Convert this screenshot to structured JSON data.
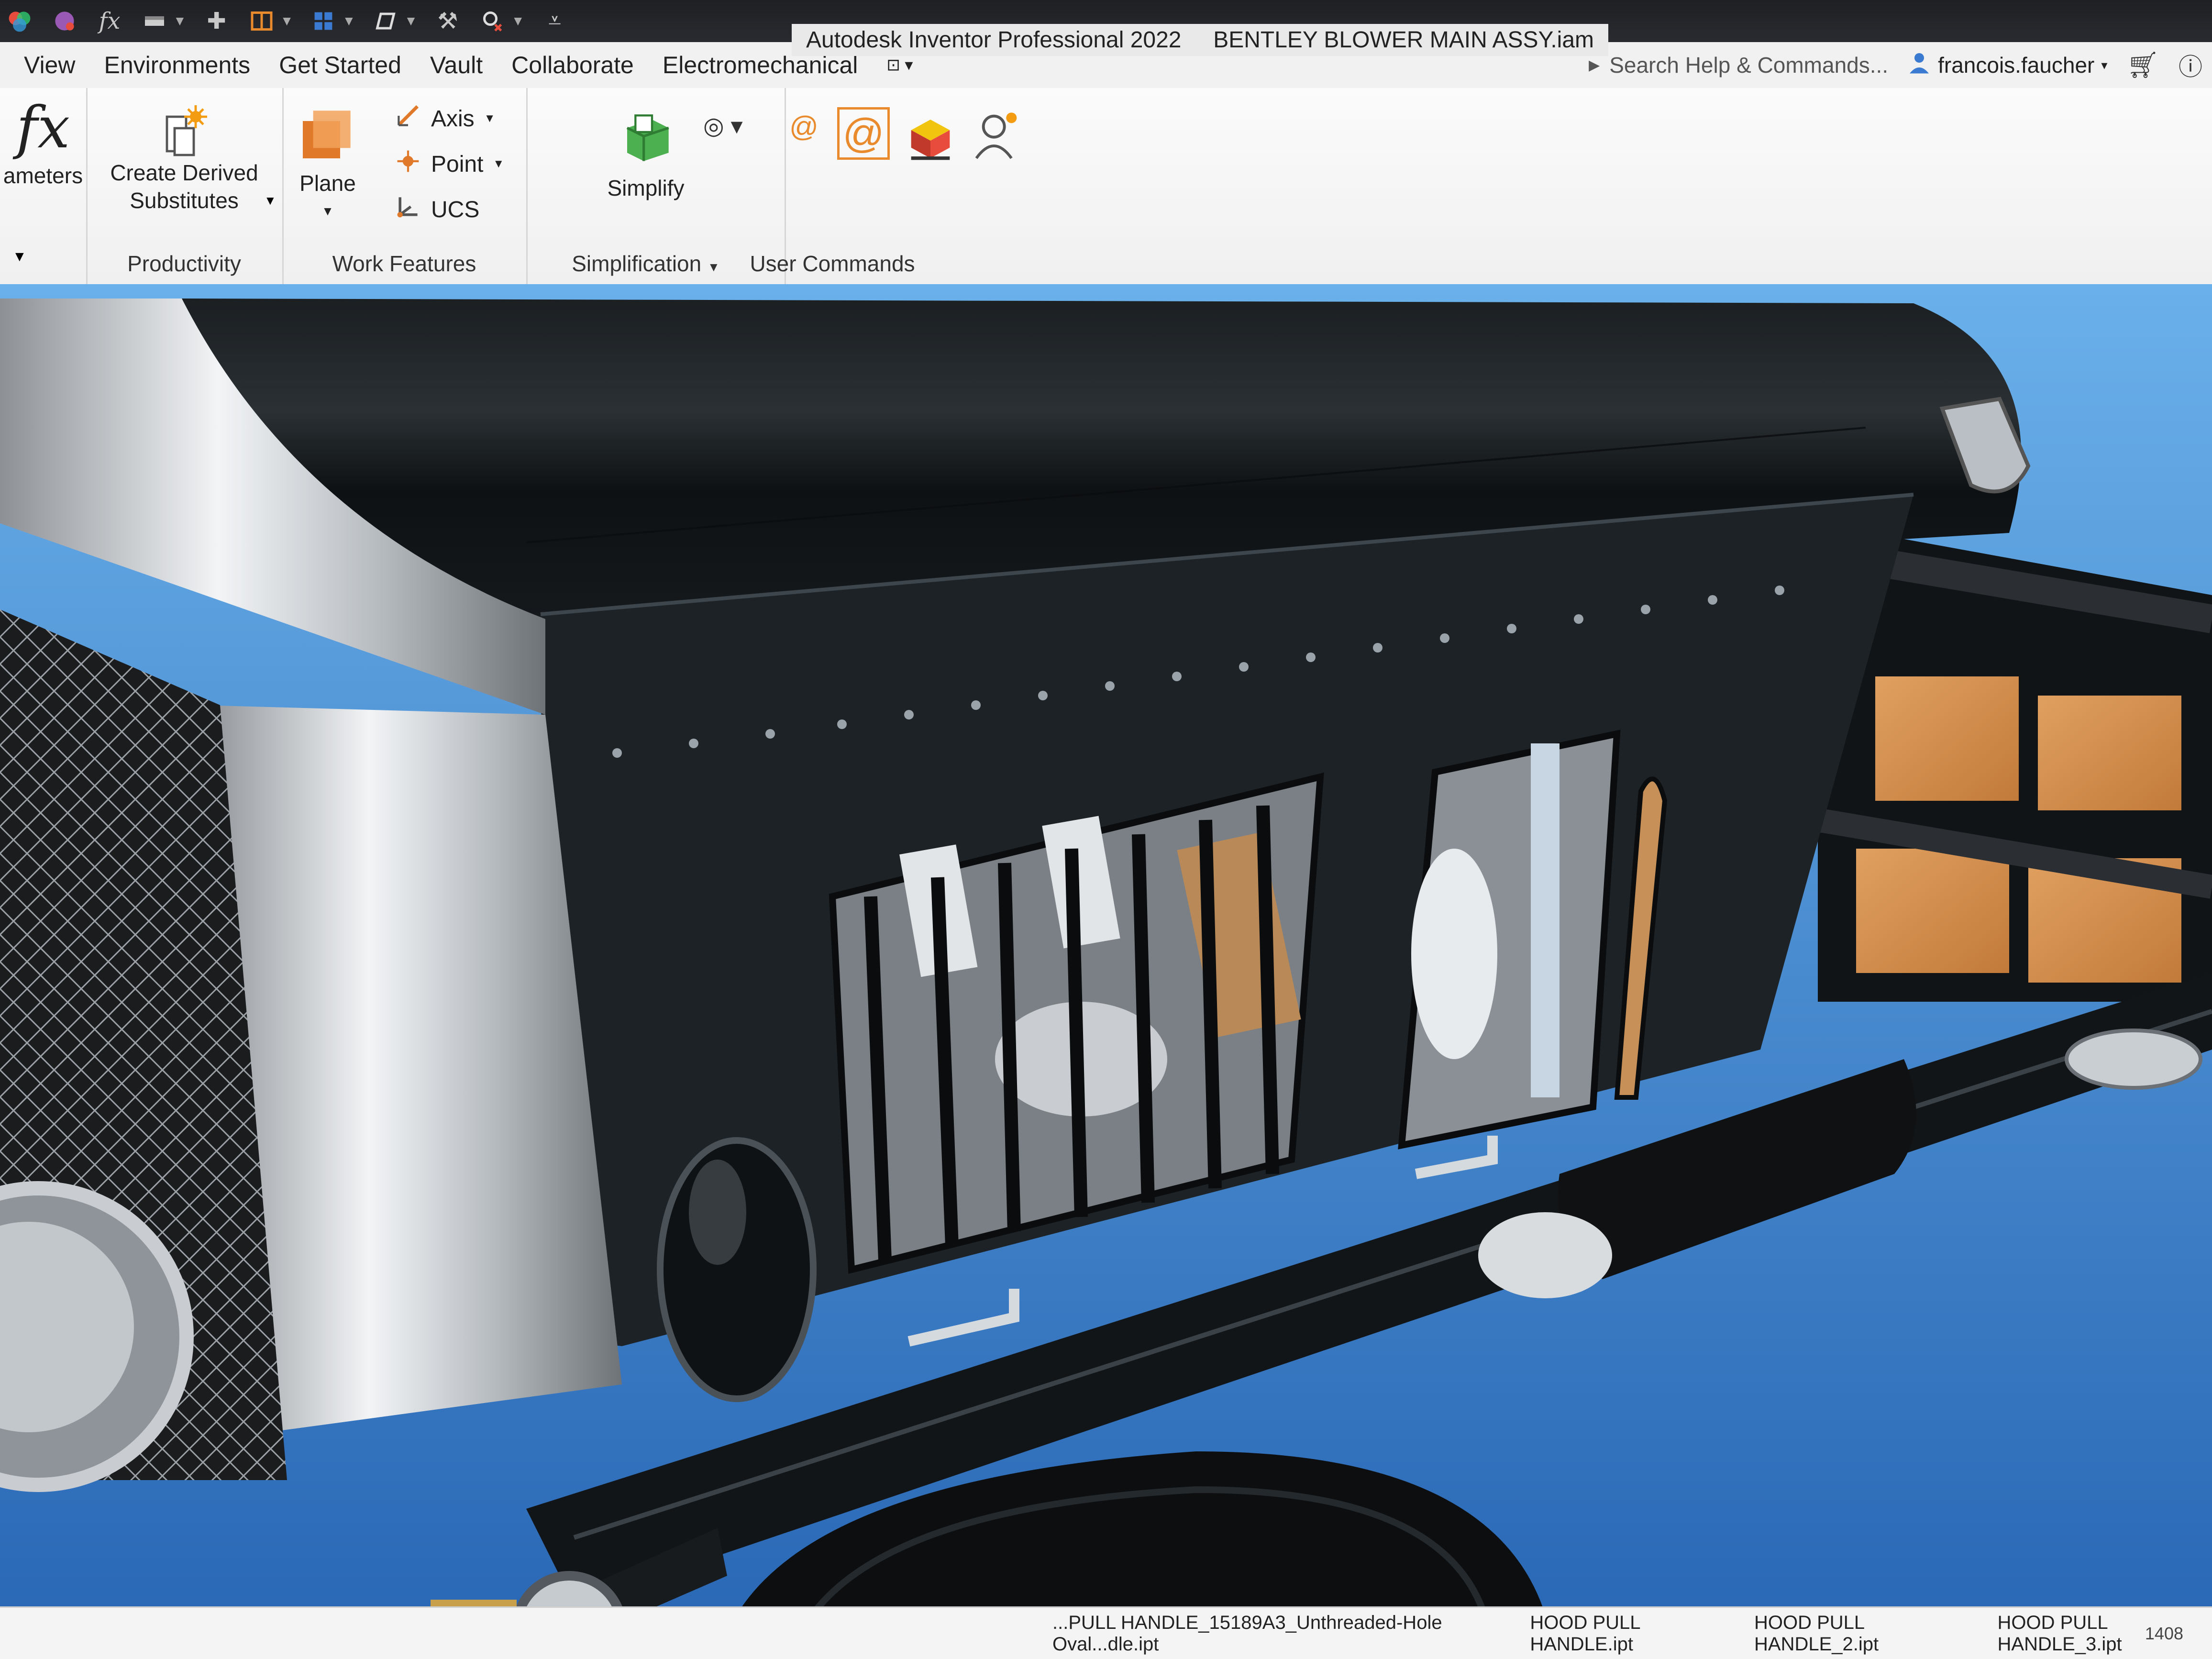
{
  "window": {
    "app_title": "Autodesk Inventor Professional 2022",
    "document_title": "BENTLEY BLOWER MAIN ASSY.iam"
  },
  "quick_access": {
    "icons": [
      "new-icon",
      "color-icon",
      "fx-icon",
      "measure-icon",
      "plus-icon",
      "split-icon",
      "grid-icon",
      "shape-icon",
      "tools-icon",
      "search-x-icon",
      "more-icon"
    ]
  },
  "tabs": [
    {
      "label": "View"
    },
    {
      "label": "Environments"
    },
    {
      "label": "Get Started"
    },
    {
      "label": "Vault"
    },
    {
      "label": "Collaborate"
    },
    {
      "label": "Electromechanical"
    }
  ],
  "search": {
    "placeholder": "Search Help & Commands..."
  },
  "user": {
    "name": "francois.faucher"
  },
  "ribbon": {
    "parameters_label": "ameters",
    "productivity": {
      "title": "Productivity",
      "create_derived_line1": "Create Derived",
      "create_derived_line2": "Substitutes"
    },
    "work_features": {
      "title": "Work Features",
      "plane_label": "Plane",
      "axis_label": "Axis",
      "point_label": "Point",
      "ucs_label": "UCS"
    },
    "simplification": {
      "title": "Simplification",
      "simplify_label": "Simplify"
    },
    "user_commands": {
      "title": "User Commands"
    }
  },
  "statusbar": {
    "files": [
      "...PULL HANDLE_15189A3_Unthreaded-Hole Oval...dle.ipt",
      "HOOD PULL HANDLE.ipt",
      "HOOD PULL HANDLE_2.ipt",
      "HOOD PULL HANDLE_3.ipt"
    ],
    "page": "1408"
  },
  "colors": {
    "accent": "#e98a2c",
    "ribbon_bg": "#f1f1f1",
    "titlebar_bg": "#222428",
    "sky": "#3f86d2",
    "body_paint": "#1c2024"
  }
}
